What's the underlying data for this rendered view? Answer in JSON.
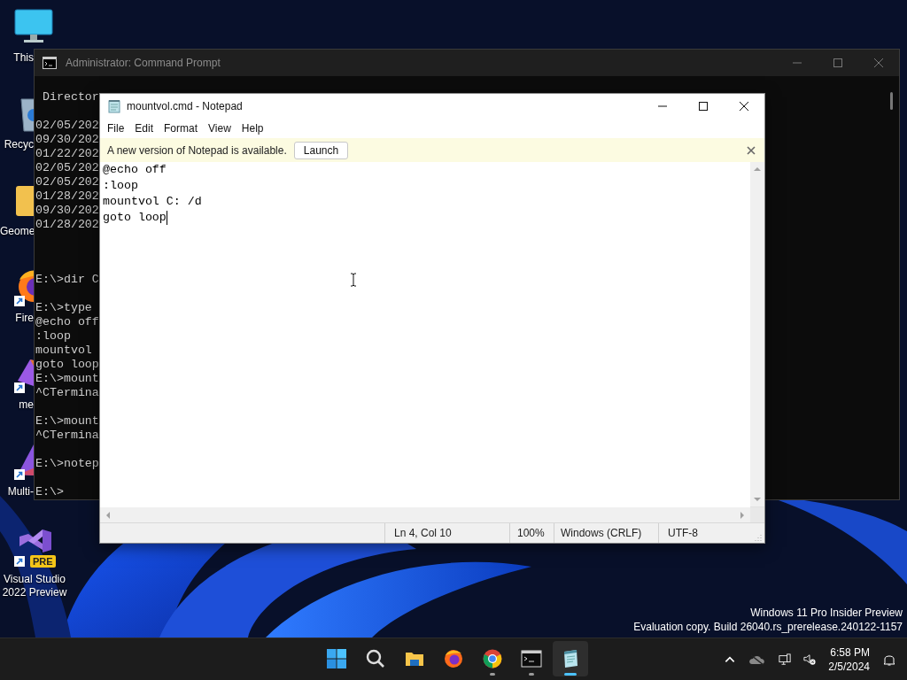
{
  "desktop_icons": [
    {
      "label": "This",
      "shortcut": false
    },
    {
      "label": "Recyc",
      "shortcut": false
    },
    {
      "label": "Geome",
      "shortcut": false
    },
    {
      "label": "Fire",
      "shortcut": true
    },
    {
      "label": "me",
      "shortcut": true
    },
    {
      "label": "Multi-",
      "shortcut": true
    },
    {
      "label": "Visual Studio 2022 Preview",
      "shortcut": true,
      "badge": "PRE"
    }
  ],
  "command_prompt": {
    "title": "Administrator: Command Prompt",
    "sections": [
      {
        "blocks": [
          [
            " Director"
          ],
          [
            "02/05/202",
            "09/30/202",
            "01/22/202",
            "02/05/202",
            "02/05/202",
            "01/28/202",
            "09/30/202",
            "01/28/202"
          ]
        ]
      },
      {
        "blocks": [
          [
            "E:\\>dir C"
          ],
          [
            "E:\\>type",
            "@echo off",
            ":loop",
            "mountvol",
            "goto loop",
            "E:\\>mount",
            "^CTermina"
          ],
          [
            "E:\\>mount",
            "^CTermina"
          ],
          [
            "E:\\>notep"
          ],
          [
            "E:\\>"
          ]
        ]
      }
    ]
  },
  "notepad": {
    "title": "mountvol.cmd - Notepad",
    "menu": [
      "File",
      "Edit",
      "Format",
      "View",
      "Help"
    ],
    "notification": {
      "message": "A new version of Notepad is available.",
      "button": "Launch"
    },
    "lines": [
      "@echo off",
      ":loop",
      "mountvol C: /d",
      "goto loop"
    ],
    "status": {
      "position": "Ln 4, Col 10",
      "zoom": "100%",
      "line_endings": "Windows (CRLF)",
      "encoding": "UTF-8"
    }
  },
  "edition_notice": [
    "Windows 11 Pro Insider Preview",
    "Evaluation copy. Build 26040.rs_prerelease.240122-1157"
  ],
  "taskbar": {
    "apps": [
      {
        "running": false,
        "active": false
      },
      {
        "running": false,
        "active": false
      },
      {
        "running": false,
        "active": false
      },
      {
        "running": false,
        "active": false
      },
      {
        "running": true,
        "active": false
      },
      {
        "running": true,
        "active": false
      },
      {
        "running": true,
        "active": true
      }
    ],
    "clock": {
      "time": "6:58 PM",
      "date": "2/5/2024"
    }
  }
}
